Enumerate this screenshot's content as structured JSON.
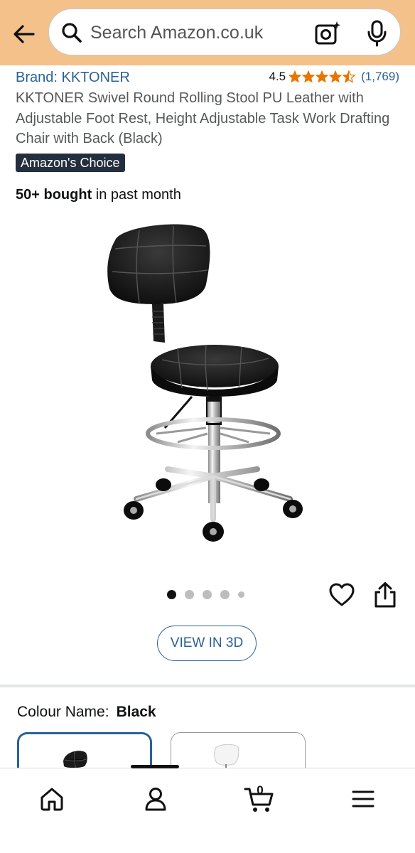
{
  "header": {
    "search_placeholder": "Search Amazon.co.uk",
    "background_color": "#f5c18b"
  },
  "product": {
    "brand": "Brand: KKTONER",
    "rating": "4.5",
    "review_count": "(1,769)",
    "title": "KKTONER Swivel Round Rolling Stool PU Leather with Adjustable Foot Rest, Height Adjustable Task Work Drafting Chair with Back (Black)",
    "badge": "Amazon's Choice",
    "bought_bold": "50+ bought",
    "bought_rest": " in past month",
    "star_color": "#e77600"
  },
  "gallery": {
    "image_count": 5,
    "active_index": 0,
    "view_3d_label": "VIEW IN 3D"
  },
  "variants": {
    "colour_label": "Colour Name:",
    "colour_value": "Black",
    "options": [
      "black-stool",
      "white-stool"
    ]
  },
  "bottom_nav": {
    "cart_count": "0",
    "items": [
      "home-icon",
      "account-icon",
      "cart-icon",
      "menu-icon"
    ]
  },
  "colors": {
    "link": "#2a6296",
    "badge_bg": "#232f3e"
  }
}
